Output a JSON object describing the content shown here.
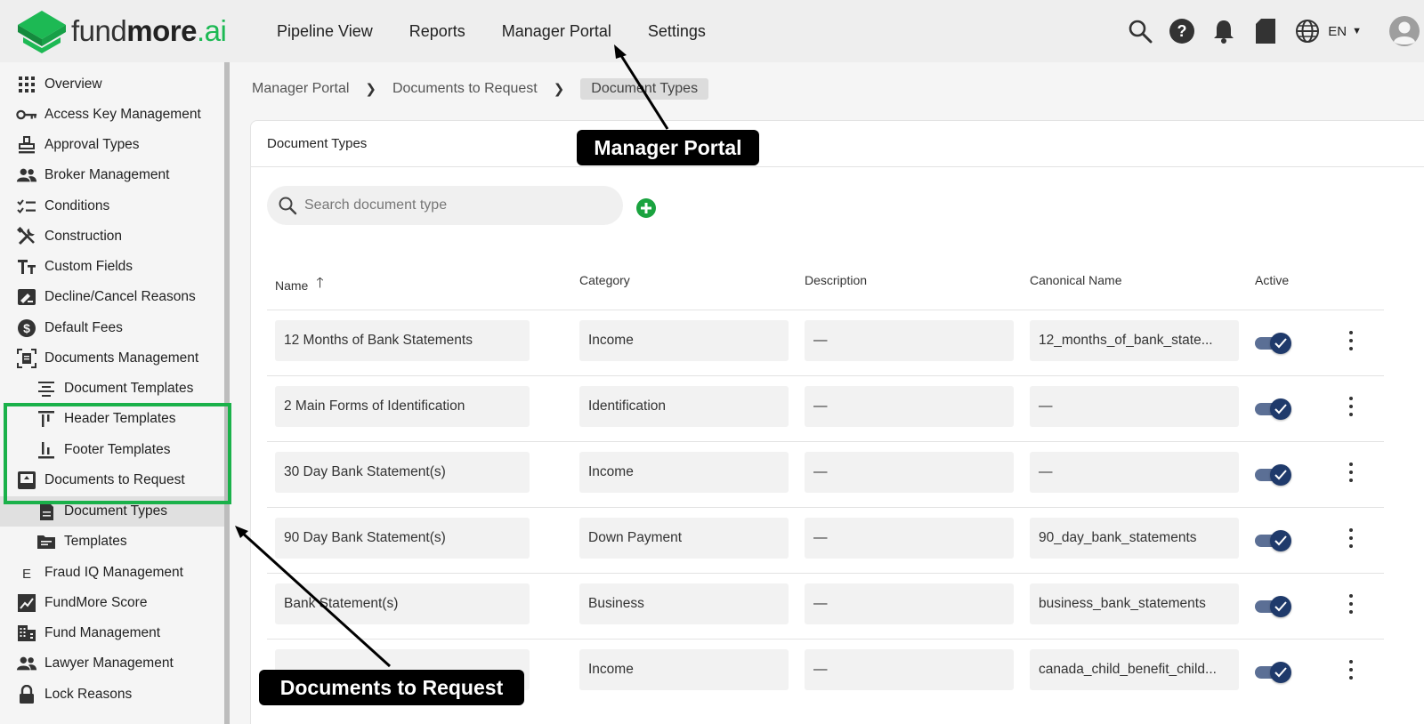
{
  "logo": {
    "part1": "fund",
    "part2": "more",
    "part3": ".ai"
  },
  "nav": [
    "Pipeline View",
    "Reports",
    "Manager Portal",
    "Settings"
  ],
  "language": "EN",
  "sidebar": [
    {
      "label": "Overview",
      "icon": "grid-icon",
      "sub": false,
      "active": false
    },
    {
      "label": "Access Key Management",
      "icon": "key-icon",
      "sub": false,
      "active": false
    },
    {
      "label": "Approval Types",
      "icon": "stamp-icon",
      "sub": false,
      "active": false
    },
    {
      "label": "Broker Management",
      "icon": "people-icon",
      "sub": false,
      "active": false
    },
    {
      "label": "Conditions",
      "icon": "checklist-icon",
      "sub": false,
      "active": false
    },
    {
      "label": "Construction",
      "icon": "tools-icon",
      "sub": false,
      "active": false
    },
    {
      "label": "Custom Fields",
      "icon": "text-size-icon",
      "sub": false,
      "active": false
    },
    {
      "label": "Decline/Cancel Reasons",
      "icon": "signature-icon",
      "sub": false,
      "active": false
    },
    {
      "label": "Default Fees",
      "icon": "dollar-icon",
      "sub": false,
      "active": false
    },
    {
      "label": "Documents Management",
      "icon": "document-frame-icon",
      "sub": false,
      "active": false
    },
    {
      "label": "Document Templates",
      "icon": "align-center-icon",
      "sub": true,
      "active": false
    },
    {
      "label": "Header Templates",
      "icon": "header-icon",
      "sub": true,
      "active": false
    },
    {
      "label": "Footer Templates",
      "icon": "footer-icon",
      "sub": true,
      "active": false
    },
    {
      "label": "Documents to Request",
      "icon": "upload-box-icon",
      "sub": false,
      "active": false
    },
    {
      "label": "Document Types",
      "icon": "file-icon",
      "sub": true,
      "active": true
    },
    {
      "label": "Templates",
      "icon": "folder-icon",
      "sub": true,
      "active": false
    },
    {
      "label": "Fraud IQ Management",
      "icon": "letter-e-icon",
      "sub": false,
      "active": false
    },
    {
      "label": "FundMore Score",
      "icon": "score-icon",
      "sub": false,
      "active": false
    },
    {
      "label": "Fund Management",
      "icon": "building-icon",
      "sub": false,
      "active": false
    },
    {
      "label": "Lawyer Management",
      "icon": "people-icon",
      "sub": false,
      "active": false
    },
    {
      "label": "Lock Reasons",
      "icon": "lock-icon",
      "sub": false,
      "active": false
    }
  ],
  "breadcrumb": [
    "Manager Portal",
    "Documents to Request",
    "Document Types"
  ],
  "card_title": "Document Types",
  "search": {
    "placeholder": "Search document type"
  },
  "columns": [
    "Name",
    "Category",
    "Description",
    "Canonical Name",
    "Active"
  ],
  "rows": [
    {
      "name": "12 Months of Bank Statements",
      "category": "Income",
      "description": "—",
      "canonical": "12_months_of_bank_state...",
      "active": true
    },
    {
      "name": "2 Main Forms of Identification",
      "category": "Identification",
      "description": "—",
      "canonical": "—",
      "active": true
    },
    {
      "name": "30 Day Bank Statement(s)",
      "category": "Income",
      "description": "—",
      "canonical": "—",
      "active": true
    },
    {
      "name": "90 Day Bank Statement(s)",
      "category": "Down Payment",
      "description": "—",
      "canonical": "90_day_bank_statements",
      "active": true
    },
    {
      "name": "Bank Statement(s)",
      "category": "Business",
      "description": "—",
      "canonical": "business_bank_statements",
      "active": true
    },
    {
      "name": "",
      "category": "Income",
      "description": "—",
      "canonical": "canada_child_benefit_child...",
      "active": true
    }
  ],
  "callouts": {
    "manager_portal": "Manager Portal",
    "documents_to_request": "Documents to Request"
  },
  "colors": {
    "brand_green": "#1db954",
    "highlight": "#1ab14a",
    "toggle": "#1f3a6b"
  }
}
